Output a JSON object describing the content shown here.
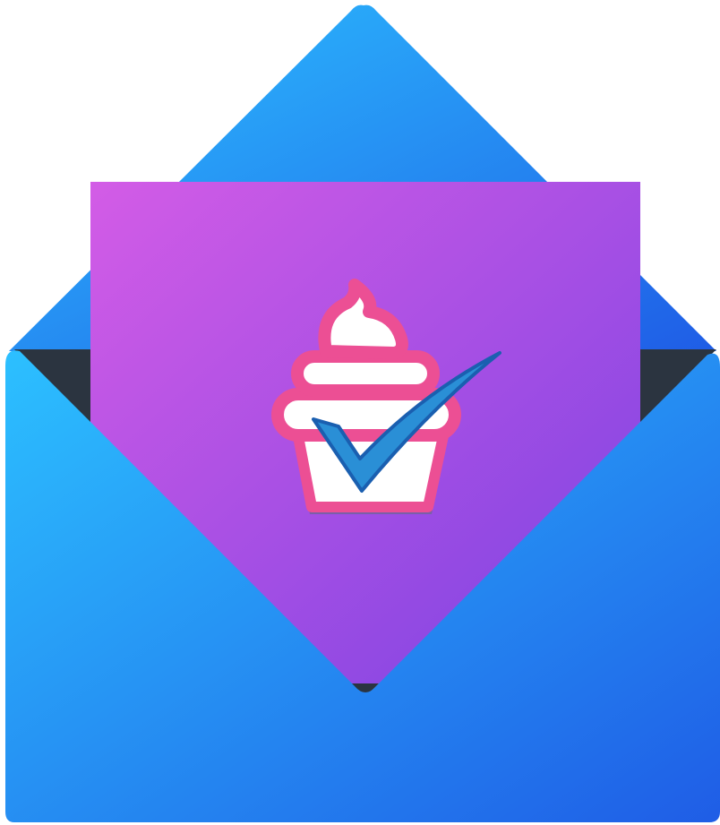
{
  "icon": {
    "subject": "envelope-with-cupcake-approval-icon",
    "parts": [
      "envelope-back-flap-icon",
      "letter-card",
      "cupcake-icon",
      "checkmark-icon",
      "envelope-front-pocket-icon"
    ]
  },
  "colors": {
    "envelope_light": "#2cc0ff",
    "envelope_dark": "#1f5de6",
    "envelope_inner": "#2b3440",
    "letter_light": "#d35ce6",
    "letter_dark": "#7b43e2",
    "cupcake_frosting": "#ec4f94",
    "cupcake_cream": "#ffffff",
    "cupcake_wrapper_shadow": "#7a5fa8",
    "checkmark": "#2a8fd6",
    "checkmark_outline": "#1a5fb0"
  }
}
